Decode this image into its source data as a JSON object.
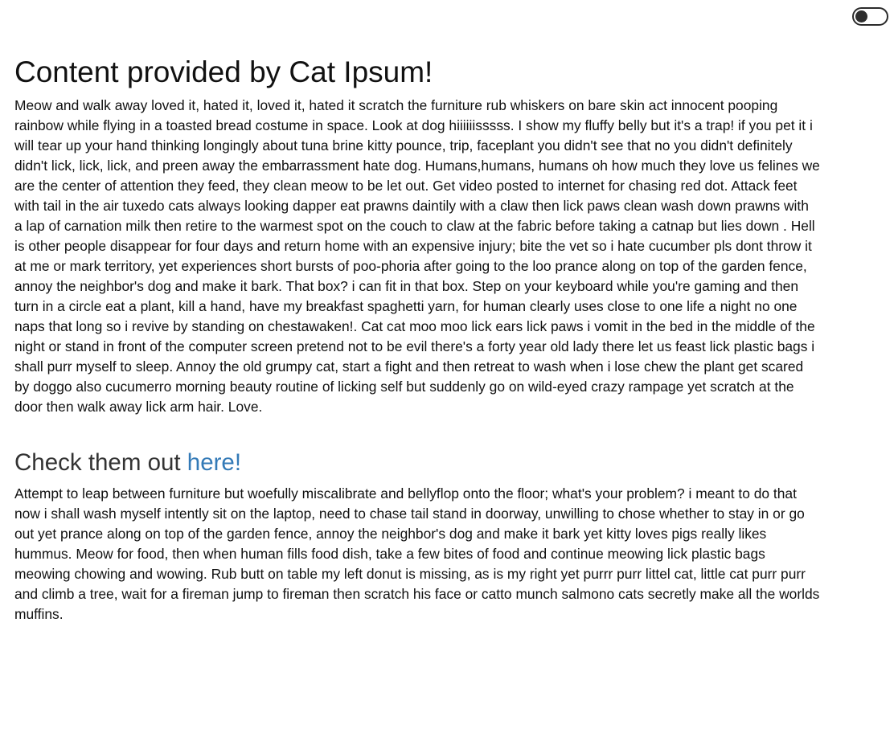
{
  "theme_toggle": {
    "state": "off"
  },
  "content": {
    "title": "Content provided by Cat Ipsum!",
    "paragraph_1": "Meow and walk away loved it, hated it, loved it, hated it scratch the furniture rub whiskers on bare skin act innocent pooping rainbow while flying in a toasted bread costume in space. Look at dog hiiiiiisssss. I show my fluffy belly but it's a trap! if you pet it i will tear up your hand thinking longingly about tuna brine kitty pounce, trip, faceplant you didn't see that no you didn't definitely didn't lick, lick, lick, and preen away the embarrassment hate dog. Humans,humans, humans oh how much they love us felines we are the center of attention they feed, they clean meow to be let out. Get video posted to internet for chasing red dot. Attack feet with tail in the air tuxedo cats always looking dapper eat prawns daintily with a claw then lick paws clean wash down prawns with a lap of carnation milk then retire to the warmest spot on the couch to claw at the fabric before taking a catnap but lies down . Hell is other people disappear for four days and return home with an expensive injury; bite the vet so i hate cucumber pls dont throw it at me or mark territory, yet experiences short bursts of poo-phoria after going to the loo prance along on top of the garden fence, annoy the neighbor's dog and make it bark. That box? i can fit in that box. Step on your keyboard while you're gaming and then turn in a circle eat a plant, kill a hand, have my breakfast spaghetti yarn, for human clearly uses close to one life a night no one naps that long so i revive by standing on chestawaken!. Cat cat moo moo lick ears lick paws i vomit in the bed in the middle of the night or stand in front of the computer screen pretend not to be evil there's a forty year old lady there let us feast lick plastic bags i shall purr myself to sleep. Annoy the old grumpy cat, start a fight and then retreat to wash when i lose chew the plant get scared by doggo also cucumerro morning beauty routine of licking self but suddenly go on wild-eyed crazy rampage yet scratch at the door then walk away lick arm hair. Love.",
    "subheading_prefix": "Check them out ",
    "subheading_link": "here!",
    "link_color": "#337ab7",
    "paragraph_2": "Attempt to leap between furniture but woefully miscalibrate and bellyflop onto the floor; what's your problem? i meant to do that now i shall wash myself intently sit on the laptop, need to chase tail stand in doorway, unwilling to chose whether to stay in or go out yet prance along on top of the garden fence, annoy the neighbor's dog and make it bark yet kitty loves pigs really likes hummus. Meow for food, then when human fills food dish, take a few bites of food and continue meowing lick plastic bags meowing chowing and wowing. Rub butt on table my left donut is missing, as is my right yet purrr purr littel cat, little cat purr purr and climb a tree, wait for a fireman jump to fireman then scratch his face or catto munch salmono cats secretly make all the worlds muffins."
  }
}
